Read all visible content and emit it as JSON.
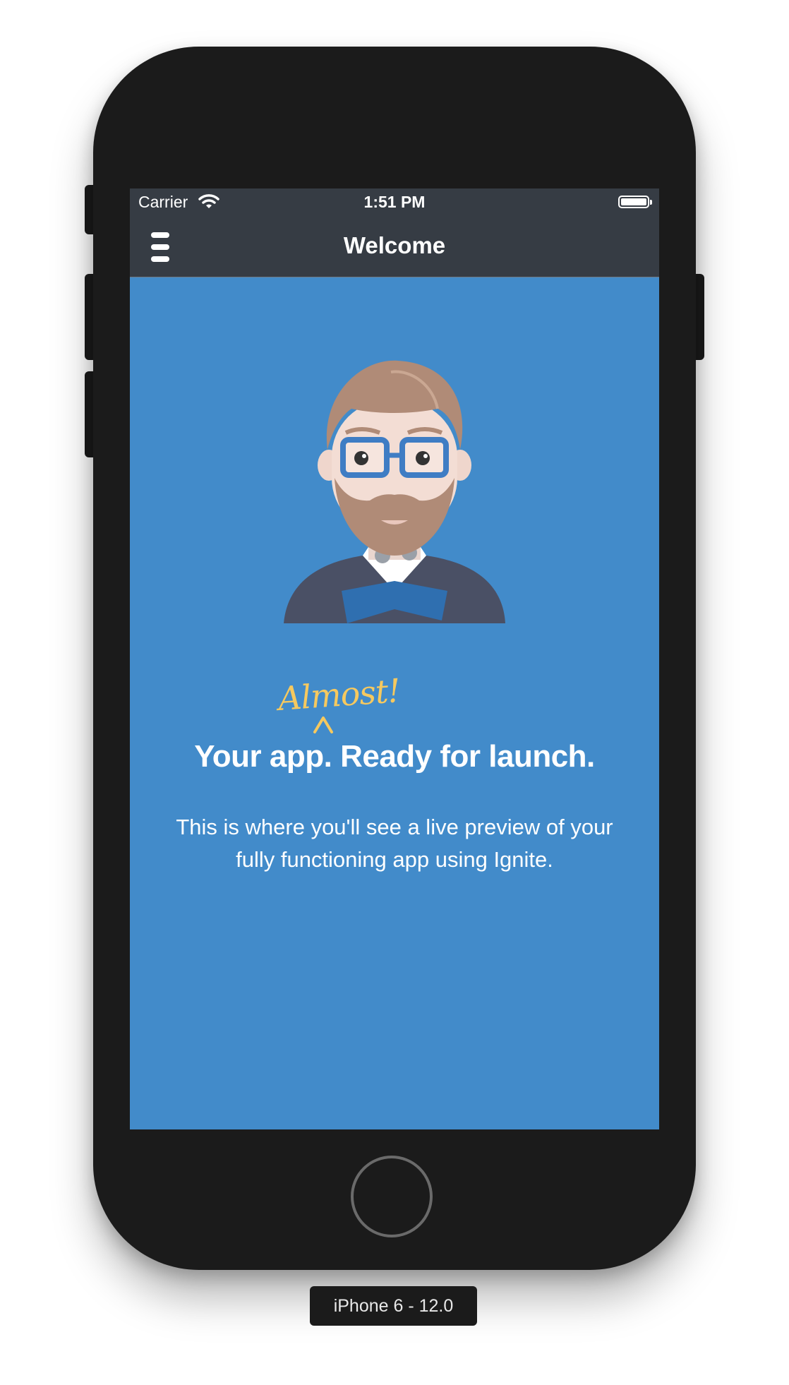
{
  "status_bar": {
    "carrier": "Carrier",
    "time": "1:51 PM",
    "wifi_icon": "wifi-icon",
    "battery_icon": "battery-icon",
    "battery_level": 1.0
  },
  "nav_bar": {
    "title": "Welcome",
    "menu_icon": "hamburger-menu-icon"
  },
  "main": {
    "illustration": "ignite-developer-avatar",
    "annotation": "Almost!",
    "headline": "Your app. Ready for launch.",
    "description": "This is where you'll see a live preview of your fully functioning app using Ignite."
  },
  "simulator": {
    "device_label": "iPhone 6 - 12.0"
  },
  "colors": {
    "screen_background": "#428bca",
    "nav_background": "#363c44",
    "annotation": "#f6c95f",
    "device_frame": "#1b1b1b"
  }
}
